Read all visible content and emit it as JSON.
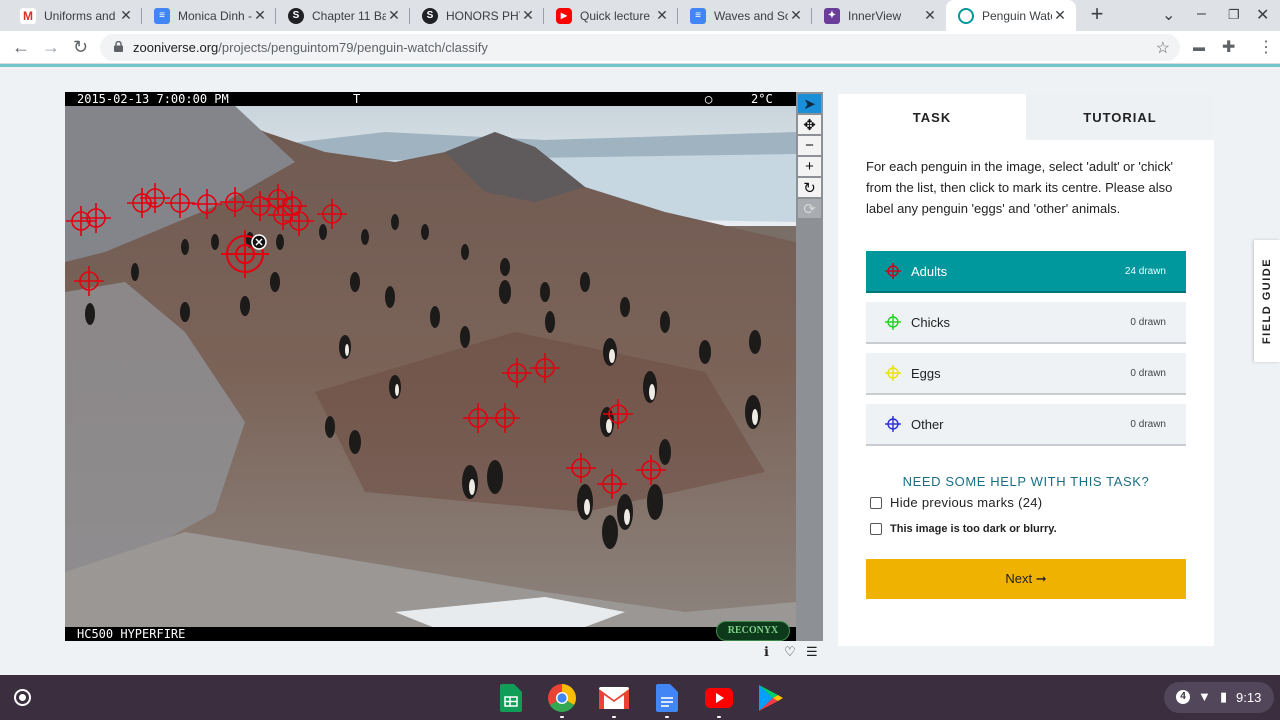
{
  "browser": {
    "tabs": [
      {
        "title": "Uniforms and",
        "icon": "gmail-icon",
        "color": "#d93025"
      },
      {
        "title": "Monica Dinh -",
        "icon": "docs-icon",
        "color": "#4285f4"
      },
      {
        "title": "Chapter 11 Ba",
        "icon": "schoology-icon",
        "color": "#202124"
      },
      {
        "title": "HONORS PHY",
        "icon": "schoology-icon",
        "color": "#202124"
      },
      {
        "title": "Quick lecture c",
        "icon": "youtube-icon",
        "color": "#ff0000"
      },
      {
        "title": "Waves and So",
        "icon": "docs-icon",
        "color": "#4285f4"
      },
      {
        "title": "InnerView",
        "icon": "innerview-icon",
        "color": "#6a3d9a"
      },
      {
        "title": "Penguin Watc",
        "icon": "zooniverse-icon",
        "color": "#00979d"
      }
    ],
    "url_host": "zooniverse.org",
    "url_path": "/projects/penguintom79/penguin-watch/classify"
  },
  "subject": {
    "camera_datetime": "2015-02-13 7:00:00 PM",
    "camera_flag": "T",
    "camera_temp": "2°C",
    "camera_model": "HC500 HYPERFIRE",
    "camera_brand": "RECONYX"
  },
  "task": {
    "tab_task": "TASK",
    "tab_tutorial": "TUTORIAL",
    "instruction": "For each penguin in the image, select 'adult' or 'chick' from the list, then click to mark its centre. Please also label any penguin 'eggs' and 'other' animals.",
    "choices": [
      {
        "label": "Adults",
        "count": "24 drawn",
        "color": "#d0021b",
        "selected": true
      },
      {
        "label": "Chicks",
        "count": "0 drawn",
        "color": "#1ed21e",
        "selected": false
      },
      {
        "label": "Eggs",
        "count": "0 drawn",
        "color": "#e8e300",
        "selected": false
      },
      {
        "label": "Other",
        "count": "0 drawn",
        "color": "#2b2bd8",
        "selected": false
      }
    ],
    "help_link": "NEED SOME HELP WITH THIS TASK?",
    "hide_marks_label": "Hide previous marks (24)",
    "too_dark_label": "This image is too dark or blurry.",
    "next_label": "Next ➞"
  },
  "field_guide_label": "FIELD GUIDE",
  "tray": {
    "notification_count": "4",
    "time": "9:13"
  }
}
